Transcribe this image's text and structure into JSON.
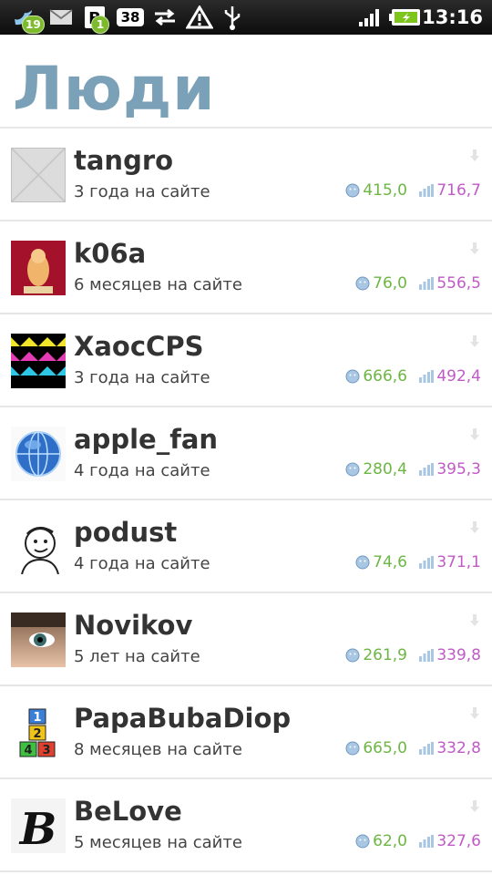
{
  "status_bar": {
    "notification_badge_1": "19",
    "notification_badge_2": "1",
    "number_icon": "38",
    "time": "13:16",
    "icons": [
      "twitter-bird-icon",
      "gmail-icon",
      "b-app-icon",
      "sync-icon",
      "warning-icon",
      "usb-icon",
      "signal-icon",
      "battery-icon"
    ]
  },
  "header": {
    "title": "Люди"
  },
  "colors": {
    "title": "#7aa1b8",
    "karma": "#6cb643",
    "rating": "#c05ac7"
  },
  "people": [
    {
      "name": "tangro",
      "since": "3 года на сайте",
      "karma": "415,0",
      "rating": "716,7",
      "avatar": "placeholder"
    },
    {
      "name": "k06a",
      "since": "6 месяцев на сайте",
      "karma": "76,0",
      "rating": "556,5",
      "avatar": "figure"
    },
    {
      "name": "XaocCPS",
      "since": "3 года на сайте",
      "karma": "666,6",
      "rating": "492,4",
      "avatar": "triangles"
    },
    {
      "name": "apple_fan",
      "since": "4 года на сайте",
      "karma": "280,4",
      "rating": "395,3",
      "avatar": "globe"
    },
    {
      "name": "podust",
      "since": "4 года на сайте",
      "karma": "74,6",
      "rating": "371,1",
      "avatar": "cartoon"
    },
    {
      "name": "Novikov",
      "since": "5 лет на сайте",
      "karma": "261,9",
      "rating": "339,8",
      "avatar": "eye"
    },
    {
      "name": "PapaBubaDiop",
      "since": "8 месяцев на сайте",
      "karma": "665,0",
      "rating": "332,8",
      "avatar": "blocks"
    },
    {
      "name": "BeLove",
      "since": "5 месяцев на сайте",
      "karma": "62,0",
      "rating": "327,6",
      "avatar": "gothic-b"
    }
  ]
}
